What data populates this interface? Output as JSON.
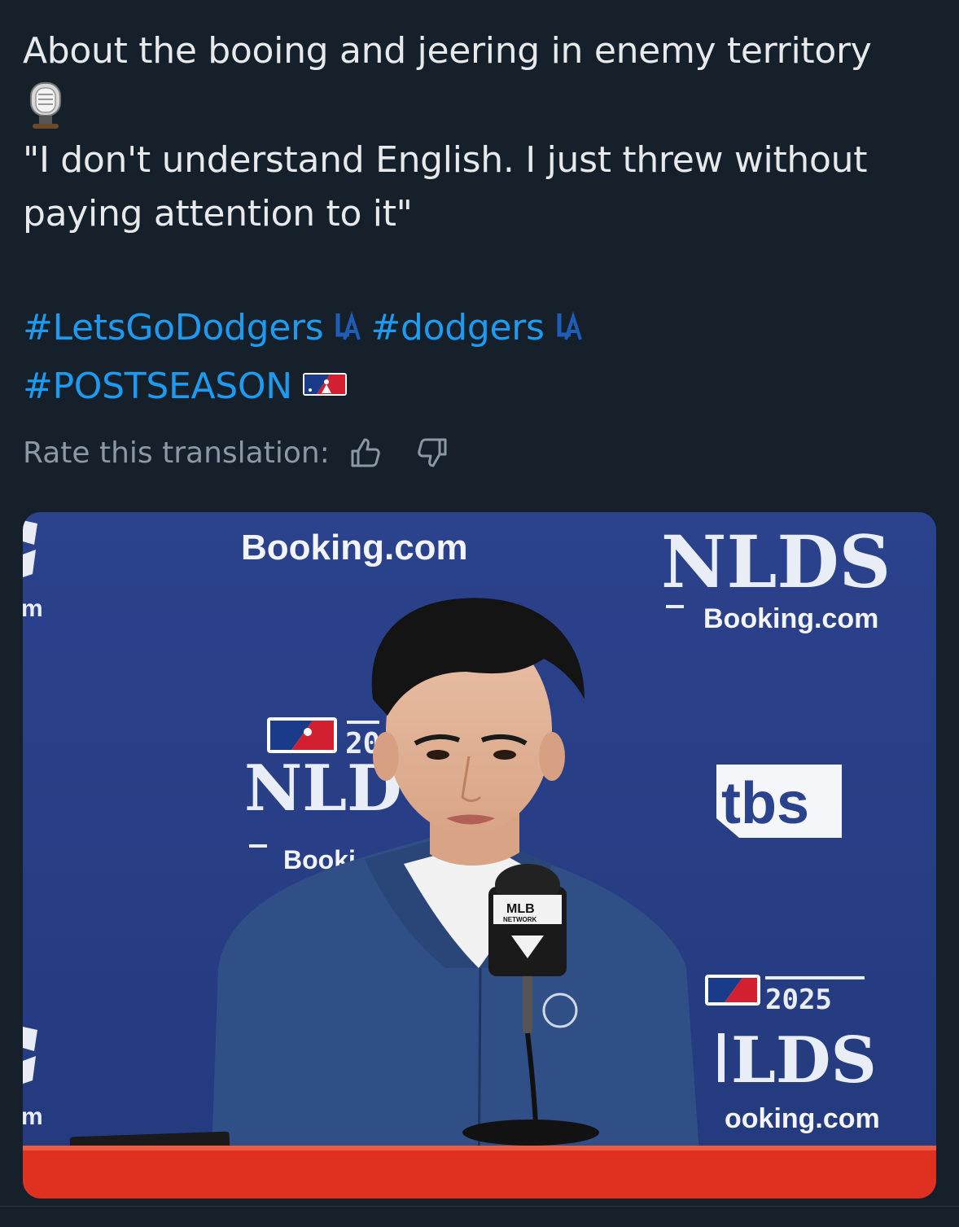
{
  "post": {
    "line1": "About the booing and jeering in enemy territory",
    "quote_line1": "\"I don't understand English. I just threw without",
    "quote_line2": "paying attention to it\"",
    "hashtags": [
      "#LetsGoDodgers",
      "#dodgers",
      "#POSTSEASON"
    ]
  },
  "translation": {
    "label": "Rate this translation:"
  },
  "image": {
    "sponsor_top": "Booking.com",
    "banner_right_title": "NLDS",
    "banner_right_sponsor": "Booking.com",
    "left_edge_m": "m",
    "banner_center_year": "20",
    "banner_center_title": "NLD",
    "banner_center_sponsor": "Booki",
    "tbs": "tbs",
    "mic_flag": "MLB",
    "mic_flag_sub": "NETWORK",
    "banner_br_year": "2025",
    "banner_br_title": "LDS",
    "banner_br_sponsor": "ooking.com"
  },
  "colors": {
    "background": "#15202b",
    "text": "#e7e9ea",
    "link": "#1d9bf0",
    "muted": "#8b98a5",
    "backdrop": "#2a3f86",
    "table": "#e03020"
  }
}
